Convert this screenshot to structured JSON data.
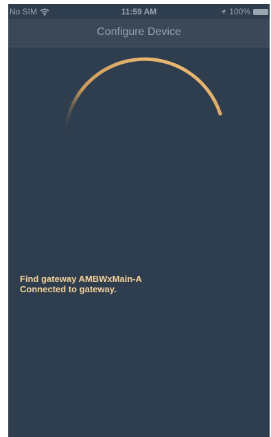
{
  "status_bar": {
    "carrier": "No SIM",
    "time": "11:59 AM",
    "battery": "100%",
    "icons": [
      "wifi-icon",
      "location-arrow-icon",
      "battery-icon"
    ]
  },
  "nav": {
    "title": "Configure Device"
  },
  "spinner": {
    "icon": "loading-spinner-arc",
    "color": "#f6c27a"
  },
  "log": {
    "lines": [
      "Find gateway AMBWxMain-A",
      "Connected to gateway."
    ],
    "color": "#f3d29a"
  },
  "colors": {
    "background": "#2f3e4f",
    "nav_background": "#3a4858"
  }
}
